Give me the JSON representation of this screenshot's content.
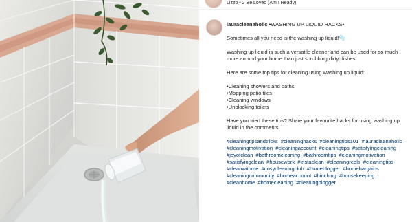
{
  "music": {
    "label": "Lizzo • 2 Be Loved (Am I Ready)"
  },
  "post": {
    "username": "lauracleanaholic",
    "headline": " •WASHING UP LIQUID HACKS•",
    "intro": "Sometimes all you need is the washing up liquid!🫧",
    "paragraph": "Washing up liquid is such a versatile cleaner and can be used for so much more around your home than just scrubbing dirty dishes.",
    "tips_intro": "Here are some top tips for cleaning using washing up liquid:",
    "tips": [
      "•Cleaning showers and baths",
      "•Mopping patio tiles",
      "•Cleaning windows",
      "•Unblocking toilets"
    ],
    "question": "Have you tried these tips? Share your favourite hacks for using washing up liquid in the comments.",
    "hashtags": [
      "#cleaningtipsandtricks",
      "#cleaninghacks",
      "#cleaningtips101",
      "#lauracleanaholic",
      "#cleaningmotivation",
      "#cleaningaccount",
      "#cleaningtips",
      "#satisfyingcleaning",
      "#joyofclean",
      "#bathroomcleaning",
      "#bathroomtips",
      "#cleaningmotivation",
      "#satisfyingclean",
      "#housework",
      "#instaclean",
      "#cleaningreels",
      "#cleaningtips",
      "#cleanwithme",
      "#cosycleaningclub",
      "#homeblogger",
      "#homebargains",
      "#cleaningcommunity",
      "#homeaccount",
      "#hinching",
      "#housekeeping",
      "#cleanhome",
      "#homecleaning",
      "#cleaningblogger"
    ]
  }
}
